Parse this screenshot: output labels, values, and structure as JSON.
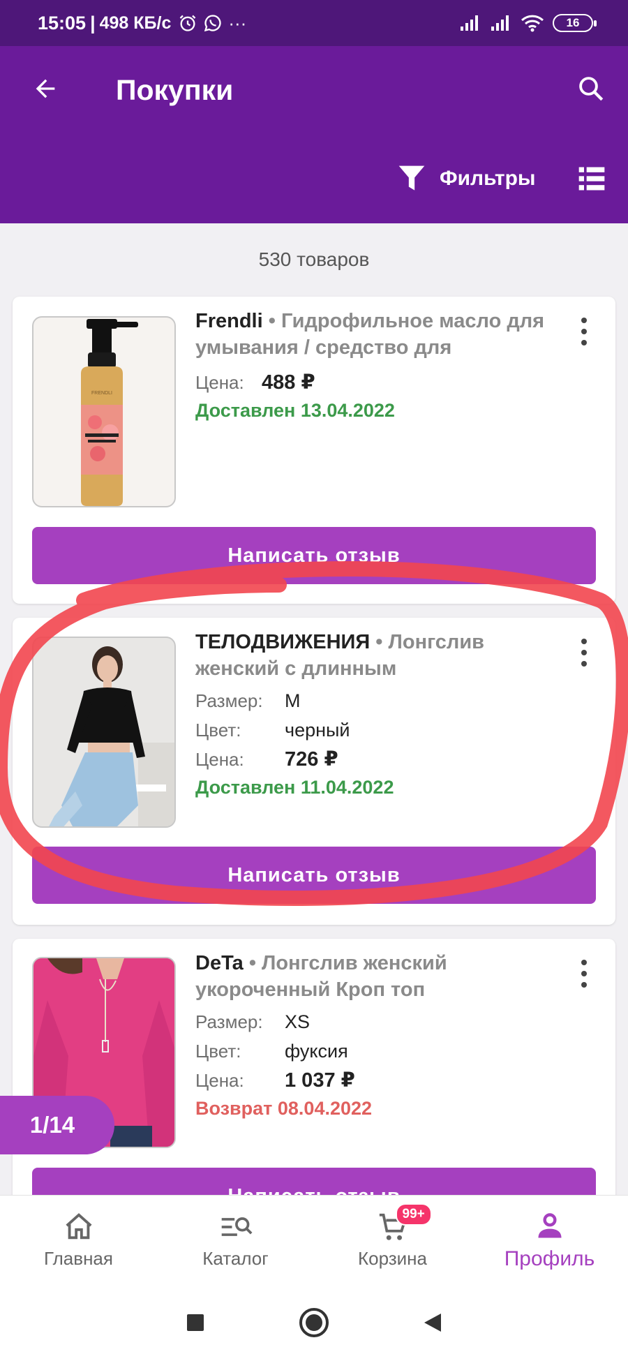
{
  "status_bar": {
    "time": "15:05",
    "speed": "498 КБ/с",
    "more": "···",
    "battery": "16"
  },
  "appbar": {
    "title": "Покупки",
    "filter_label": "Фильтры"
  },
  "product_count": "530 товаров",
  "labels": {
    "size": "Размер:",
    "color": "Цвет:",
    "price": "Цена:"
  },
  "products": [
    {
      "brand": "Frendli",
      "separator": " • ",
      "name": "Гидрофильное масло для умывания / средство для",
      "price": "488 ₽",
      "status": "Доставлен 13.04.2022",
      "status_color": "#3c9a4a",
      "review_button": "Написать отзыв",
      "image_label": "МАСЛО ДЛЯ УМЫВАНИЯ",
      "image_brand": "FRENDLI"
    },
    {
      "brand": "ТЕЛОДВИЖЕНИЯ",
      "separator": " • ",
      "name": "Лонгслив женский с длинным",
      "size": "M",
      "color": "черный",
      "price": "726 ₽",
      "status": "Доставлен 11.04.2022",
      "status_color": "#3c9a4a",
      "review_button": "Написать отзыв"
    },
    {
      "brand": "DeTa",
      "separator": " • ",
      "name": "Лонгслив женский укороченный Кроп топ",
      "size": "XS",
      "color": "фуксия",
      "price": "1 037 ₽",
      "status": "Возврат 08.04.2022",
      "status_color": "#e0605e",
      "review_button": "Написать отзыв"
    }
  ],
  "pager": "1/14",
  "bottom_nav": [
    {
      "label": "Главная",
      "icon": "home-icon"
    },
    {
      "label": "Каталог",
      "icon": "catalog-search-icon"
    },
    {
      "label": "Корзина",
      "icon": "cart-icon",
      "badge": "99+"
    },
    {
      "label": "Профиль",
      "icon": "profile-icon",
      "active": true
    }
  ],
  "colors": {
    "appbar": "#6a1b9a",
    "statusbar": "#4e1779",
    "accent": "#a540bf",
    "delivered": "#3c9a4a",
    "returned": "#e0605e",
    "badge": "#f5346a",
    "highlight": "#f2464f"
  }
}
